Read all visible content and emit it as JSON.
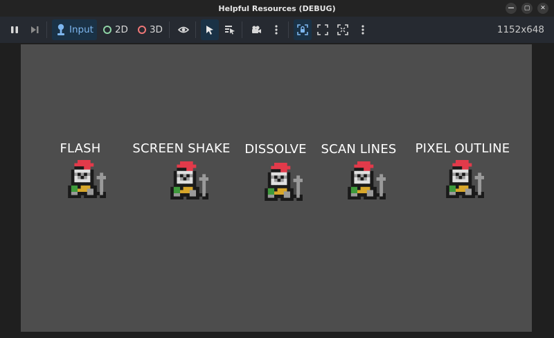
{
  "window": {
    "title": "Helpful Resources (DEBUG)",
    "controls": [
      {
        "name": "minimize-button",
        "glyph": "—"
      },
      {
        "name": "maximize-button",
        "glyph": "▢"
      },
      {
        "name": "close-button",
        "glyph": "✕"
      }
    ]
  },
  "toolbar": {
    "input_label": "Input",
    "mode_2d_label": "2D",
    "mode_3d_label": "3D",
    "resolution": "1152x648",
    "accent_color": "#7db6ee",
    "color_2d": "#8fd4a5",
    "color_3d": "#f07777"
  },
  "effects": [
    {
      "label": "FLASH"
    },
    {
      "label": "SCREEN SHAKE"
    },
    {
      "label": "DISSOLVE"
    },
    {
      "label": "SCAN LINES"
    },
    {
      "label": "PIXEL OUTLINE"
    }
  ],
  "sprite": {
    "name": "knight-sprite"
  }
}
